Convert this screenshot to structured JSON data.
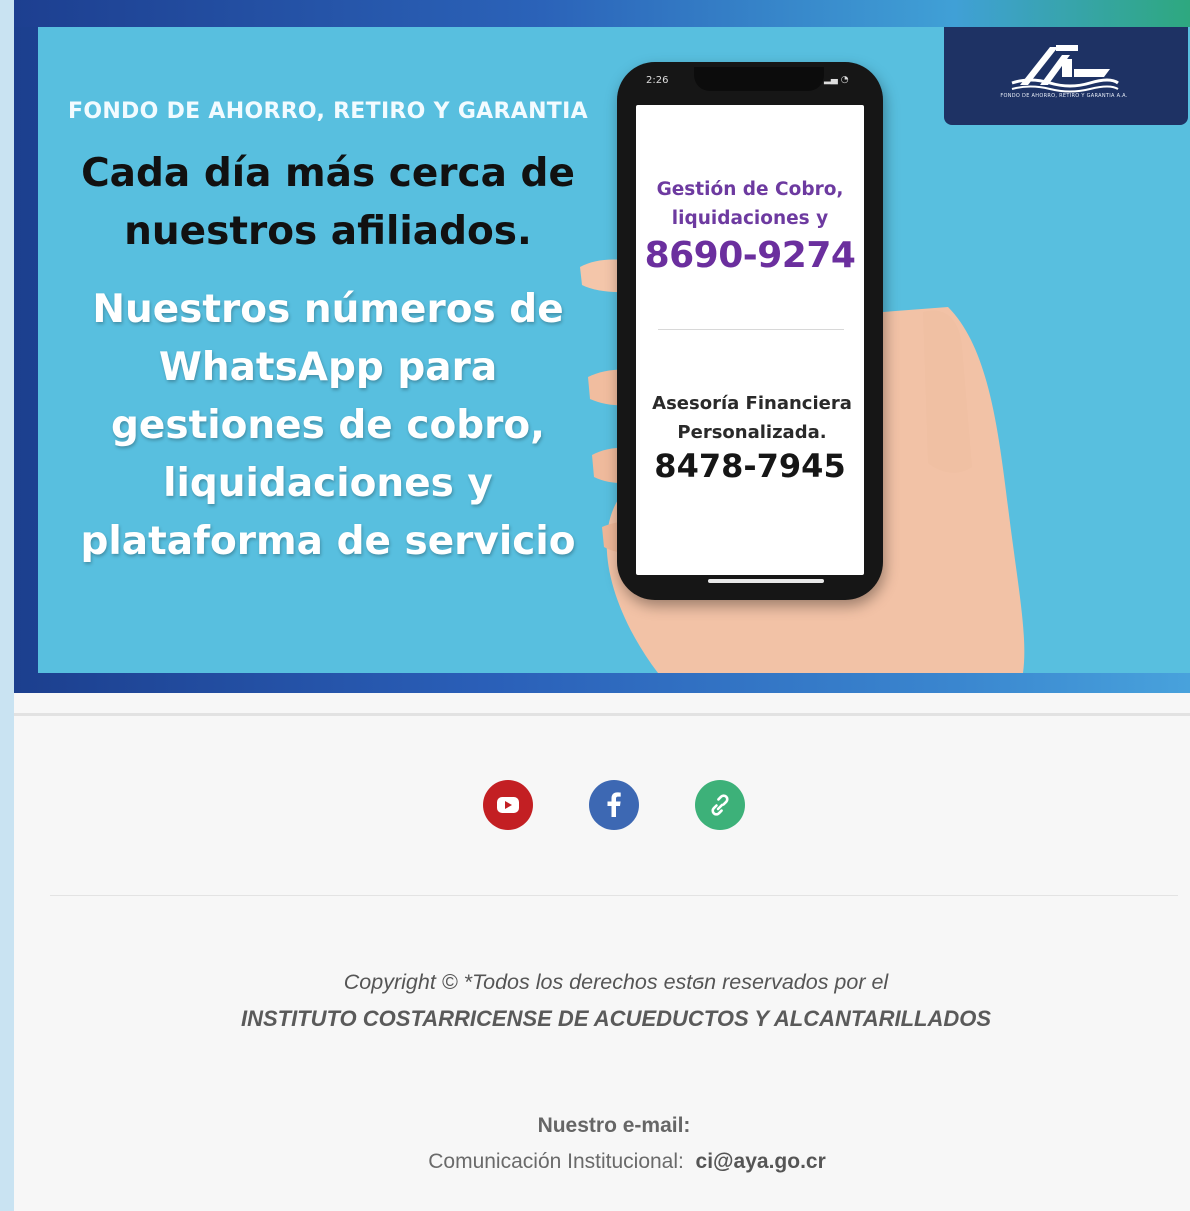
{
  "banner": {
    "fund_name": "FONDO DE AHORRO, RETIRO Y GARANTIA",
    "headline": "Cada día más cerca de nuestros afiliados.",
    "subtext": "Nuestros números de WhatsApp para gestiones de cobro, liquidaciones y plataforma de servicio",
    "logo_caption": "FONDO DE AHORRO, RETIRO Y GARANTIA A.A."
  },
  "phone": {
    "status_time": "2:26",
    "screen": {
      "label_1": "Gestión de Cobro, liquidaciones y",
      "number_1": "8690-9274",
      "label_2": "Asesoría Financiera Personalizada.",
      "number_2": "8478-7945"
    }
  },
  "social": [
    {
      "name": "youtube",
      "icon": "youtube-icon",
      "color": "#c31f23"
    },
    {
      "name": "facebook",
      "icon": "facebook-icon",
      "color": "#3d68b3"
    },
    {
      "name": "link",
      "icon": "link-icon",
      "color": "#3db179"
    }
  ],
  "footer": {
    "copyright_line": "Copyright © *Todos los derechos estϭn  reservados por el",
    "institution": "INSTITUTO COSTARRICENSE DE ACUEDUCTOS Y ALCANTARILLADOS",
    "email_title": "Nuestro e-mail:",
    "email_label": "Comunicación Institucional:",
    "email_address": "ci@aya.go.cr"
  },
  "colors": {
    "banner_bg": "#58bfdf",
    "banner_frame": "#1c3f8e",
    "logo_bg": "#1e3264",
    "phone_number_1": "#6b2f9e",
    "page_bg": "#f7f7f7"
  }
}
